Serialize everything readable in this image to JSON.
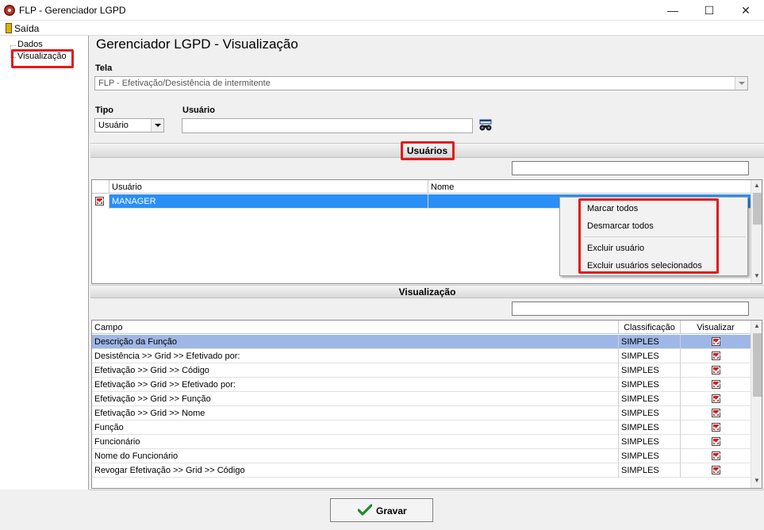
{
  "window": {
    "title": "FLP - Gerenciador LGPD",
    "min_glyph": "—",
    "max_glyph": "☐",
    "close_glyph": "✕"
  },
  "menu": {
    "exit_label": "Saída"
  },
  "tree": {
    "items": [
      "Dados",
      "Visualização"
    ]
  },
  "page": {
    "title": "Gerenciador LGPD - Visualização"
  },
  "tela": {
    "label": "Tela",
    "value": "FLP - Efetivação/Desistência de intermitente"
  },
  "tipo": {
    "label": "Tipo",
    "value": "Usuário"
  },
  "usuario": {
    "label": "Usuário",
    "value": ""
  },
  "users_section": {
    "title": "Usuários",
    "search_value": "",
    "columns": [
      "Usuário",
      "Nome"
    ],
    "rows": [
      {
        "checked": true,
        "usuario": "MANAGER",
        "nome": ""
      }
    ]
  },
  "context_menu": {
    "items": [
      "Marcar todos",
      "Desmarcar todos",
      "Excluir usuário",
      "Excluir usuários selecionados"
    ]
  },
  "vis_section": {
    "title": "Visualização",
    "search_value": "",
    "columns": [
      "Campo",
      "Classificação",
      "Visualizar"
    ],
    "rows": [
      {
        "campo": "Descrição da Função",
        "classificacao": "SIMPLES",
        "visualizar": true
      },
      {
        "campo": "Desistência >> Grid >> Efetivado por:",
        "classificacao": "SIMPLES",
        "visualizar": true
      },
      {
        "campo": "Efetivação >> Grid >> Código",
        "classificacao": "SIMPLES",
        "visualizar": true
      },
      {
        "campo": "Efetivação >> Grid >> Efetivado por:",
        "classificacao": "SIMPLES",
        "visualizar": true
      },
      {
        "campo": "Efetivação >> Grid >> Função",
        "classificacao": "SIMPLES",
        "visualizar": true
      },
      {
        "campo": "Efetivação >> Grid >> Nome",
        "classificacao": "SIMPLES",
        "visualizar": true
      },
      {
        "campo": "Função",
        "classificacao": "SIMPLES",
        "visualizar": true
      },
      {
        "campo": "Funcionário",
        "classificacao": "SIMPLES",
        "visualizar": true
      },
      {
        "campo": "Nome do Funcionário",
        "classificacao": "SIMPLES",
        "visualizar": true
      },
      {
        "campo": "Revogar Efetivação >> Grid >> Código",
        "classificacao": "SIMPLES",
        "visualizar": true
      }
    ]
  },
  "footer": {
    "save_label": "Gravar"
  },
  "colors": {
    "highlight_red": "#e21b1b",
    "selection_blue": "#2a8ff7",
    "selection_light": "#9fb7e6",
    "check_red": "#d21a1a"
  },
  "icons": {
    "app": "app-logo-icon",
    "exit": "door-icon",
    "user_lookup": "binoculars-icon",
    "search": "magnifier-icon",
    "save": "checkmark-icon"
  }
}
